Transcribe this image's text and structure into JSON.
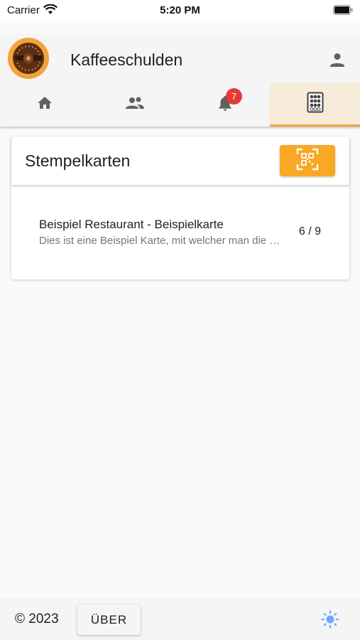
{
  "status_bar": {
    "carrier": "Carrier",
    "time": "5:20 PM"
  },
  "app_bar": {
    "title": "Kaffeeschulden",
    "logo_icon": "coffee-logo-icon",
    "account_icon": "account-icon"
  },
  "tabs": [
    {
      "name": "home",
      "icon": "home-icon",
      "active": false
    },
    {
      "name": "friends",
      "icon": "people-icon",
      "active": false
    },
    {
      "name": "notifications",
      "icon": "bell-icon",
      "active": false,
      "badge": "7"
    },
    {
      "name": "stamp-cards",
      "icon": "stamp-card-icon",
      "active": true
    }
  ],
  "card": {
    "title": "Stempelkarten",
    "scan_button_icon": "qr-scan-icon",
    "items": [
      {
        "title": "Beispiel Restaurant - Beispielkarte",
        "subtitle": "Dies ist eine Beispiel Karte, mit welcher man die Funktionen testen kann",
        "count": "6 / 9"
      }
    ]
  },
  "footer": {
    "copyright": "© 2023",
    "about_label": "ÜBER",
    "theme_icon": "sun-icon"
  },
  "colors": {
    "accent": "#f9a825",
    "active_tab_bg": "#f7ebd9",
    "badge": "#e53935",
    "icon_grey": "#616161",
    "theme_icon": "#6ea8ff"
  }
}
